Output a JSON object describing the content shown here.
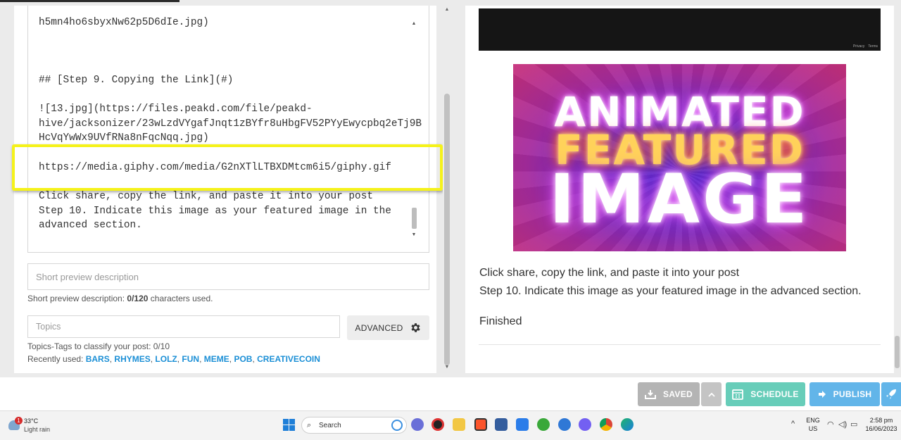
{
  "editor": {
    "lines": [
      "h5mn4ho6sbyxNw62p5D6dIe.jpg)",
      "## [Step 9. Copying the Link](#)",
      "![13.jpg](https://files.peakd.com/file/peakd-",
      "hive/jacksonizer/23wLzdVYgafJnqt1zBYfr8uHbgFV52PYyEwycpbq2eTj9B",
      "HcVqYwWx9UVfRNa8nFqcNqq.jpg)",
      "https://media.giphy.com/media/G2nXTlLTBXDMtcm6i5/giphy.gif",
      "Click share, copy the link, and paste it into your post",
      "Step 10. Indicate this image as your featured image in the",
      "advanced section."
    ]
  },
  "short_desc": {
    "placeholder": "Short preview description",
    "note_prefix": "Short preview description: ",
    "note_count": "0/120",
    "note_suffix": " characters used."
  },
  "topics": {
    "placeholder": "Topics",
    "note": "Topics-Tags to classify your post: 0/10",
    "recent_label": "Recently used: ",
    "recent": [
      "BARS",
      "RHYMES",
      "LOLZ",
      "FUN",
      "MEME",
      "POB",
      "CREATIVECOIN"
    ]
  },
  "advanced_label": "ADVANCED",
  "preview": {
    "video_links": [
      "Privacy",
      "Terms"
    ],
    "image_text": [
      "ANIMATED",
      "FEATURED",
      "IMAGE"
    ],
    "line1": "Click share, copy the link, and paste it into your post",
    "line2": "Step 10. Indicate this image as your featured image in the advanced section.",
    "finished": "Finished"
  },
  "actions": {
    "saved": "SAVED",
    "schedule": "SCHEDULE",
    "publish": "PUBLISH"
  },
  "taskbar": {
    "weather_badge": "1",
    "temp": "33°C",
    "condition": "Light rain",
    "search": "Search",
    "lang_top": "ENG",
    "lang_bottom": "US",
    "time": "2:58 pm",
    "date": "16/06/2023"
  },
  "colors": {
    "highlight": "#f5f21a",
    "link_blue": "#1b8fd6",
    "schedule_green": "#67cdb9",
    "publish_blue": "#62b5e9",
    "saved_gray": "#b4b4b4"
  }
}
